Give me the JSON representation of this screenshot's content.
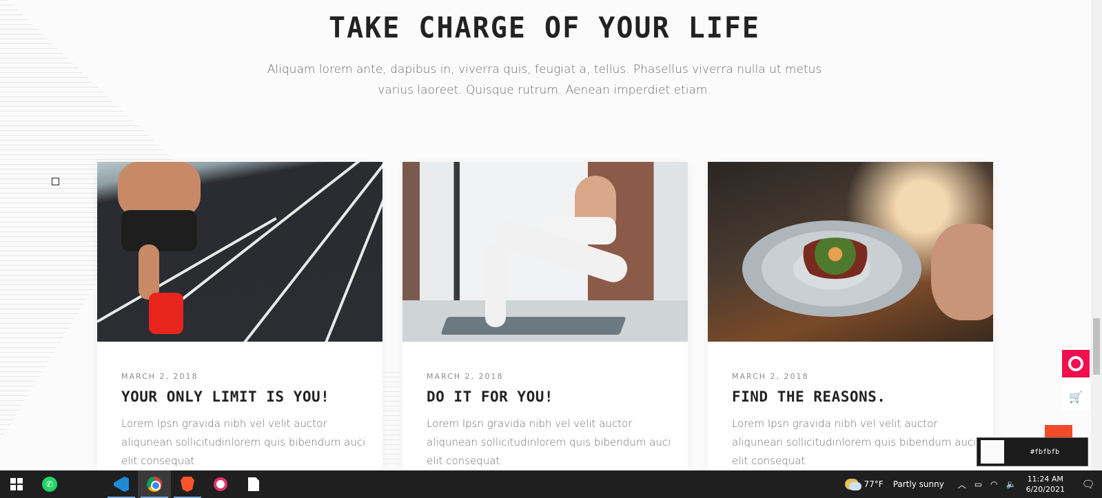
{
  "section": {
    "heading": "TAKE CHARGE OF YOUR LIFE",
    "subtitle": "Aliquam lorem ante, dapibus in, viverra quis, feugiat a, tellus. Phasellus viverra nulla ut metus varius laoreet. Quisque rutrum. Aenean imperdiet etiam."
  },
  "posts": [
    {
      "date": "MARCH 2, 2018",
      "title": "YOUR ONLY LIMIT IS YOU!",
      "excerpt": "Lorem Ipsn gravida nibh vel velit auctor aliqunean sollicitudinlorem quis bibendum auci elit consequat",
      "image": "runner-on-track"
    },
    {
      "date": "MARCH 2, 2018",
      "title": "DO IT FOR YOU!",
      "excerpt": "Lorem Ipsn gravida nibh vel velit auctor aliqunean sollicitudinlorem quis bibendum auci elit consequat",
      "image": "woman-stretching"
    },
    {
      "date": "MARCH 2, 2018",
      "title": "FIND THE REASONS.",
      "excerpt": "Lorem Ipsn gravida nibh vel velit auctor aliqunean sollicitudinlorem quis bibendum auci elit consequat",
      "image": "plated-dish"
    }
  ],
  "color_picker": {
    "hex": "#fbfbfb"
  },
  "taskbar": {
    "apps": [
      "windows-start",
      "whatsapp",
      "vscode",
      "chrome",
      "brave",
      "instagram",
      "file"
    ],
    "weather_temp": "77°F",
    "weather_text": "Partly sunny",
    "time": "11:24 AM",
    "date": "6/20/2021"
  },
  "colors": {
    "accent": "#f0104e",
    "scroll_top": "#f14b2c",
    "page_bg": "#fbfbfb"
  }
}
